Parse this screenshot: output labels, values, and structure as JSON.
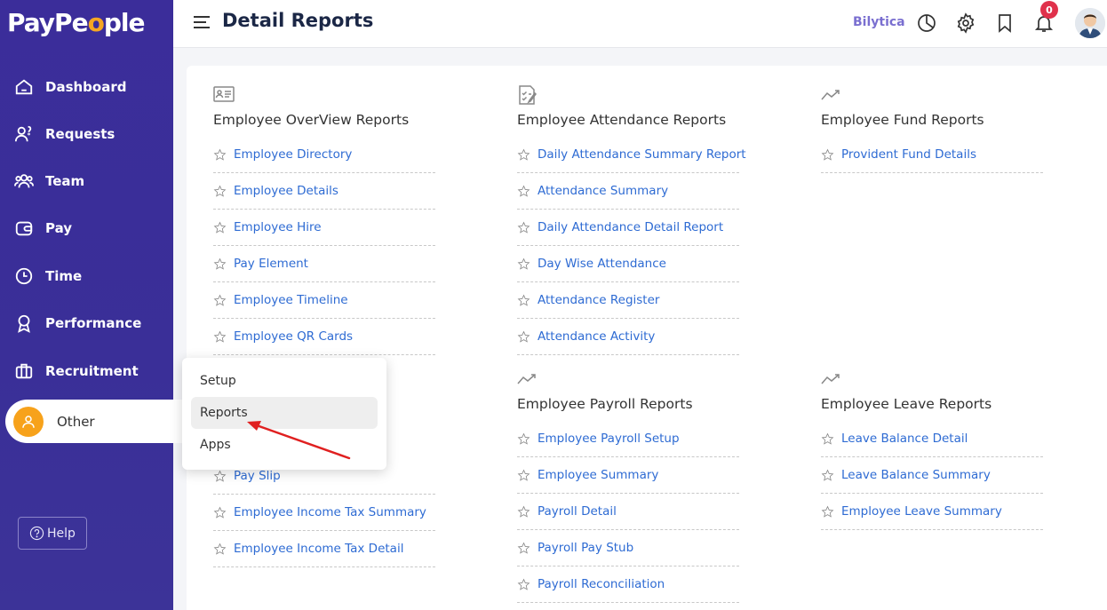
{
  "app": {
    "logo_main": "PayPe",
    "logo_accent": "o",
    "logo_end": "ple"
  },
  "sidebar": {
    "items": [
      {
        "label": "Dashboard",
        "icon": "home-icon"
      },
      {
        "label": "Requests",
        "icon": "requests-icon"
      },
      {
        "label": "Team",
        "icon": "team-icon"
      },
      {
        "label": "Pay",
        "icon": "wallet-icon"
      },
      {
        "label": "Time",
        "icon": "clock-icon"
      },
      {
        "label": "Performance",
        "icon": "award-icon"
      },
      {
        "label": "Recruitment",
        "icon": "briefcase-icon"
      }
    ],
    "other_label": "Other",
    "help_label": "Help"
  },
  "header": {
    "title": "Detail Reports",
    "org_name": "Bilytica",
    "notification_count": "0"
  },
  "sections": {
    "overview": {
      "title": "Employee OverView Reports",
      "items": [
        "Employee Directory",
        "Employee Details",
        "Employee Hire",
        "Pay Element",
        "Employee Timeline",
        "Employee QR Cards"
      ]
    },
    "attendance": {
      "title": "Employee Attendance Reports",
      "items": [
        "Daily Attendance Summary Report",
        "Attendance Summary",
        "Daily Attendance Detail Report",
        "Day Wise Attendance",
        "Attendance Register",
        "Attendance Activity"
      ]
    },
    "fund": {
      "title": "Employee Fund Reports",
      "items": [
        "Provident Fund Details"
      ]
    },
    "payslip": {
      "items": [
        "Pay Slip",
        "Employee Income Tax Summary",
        "Employee Income Tax Detail"
      ]
    },
    "payroll": {
      "title": "Employee Payroll Reports",
      "items": [
        "Employee Payroll Setup",
        "Employee Summary",
        "Payroll Detail",
        "Payroll Pay Stub",
        "Payroll Reconciliation"
      ]
    },
    "leave": {
      "title": "Employee Leave Reports",
      "items": [
        "Leave Balance Detail",
        "Leave Balance Summary",
        "Employee Leave Summary"
      ]
    }
  },
  "popup": {
    "items": [
      "Setup",
      "Reports",
      "Apps"
    ],
    "active": "Reports"
  },
  "colors": {
    "sidebar": "#3b2d9a",
    "link": "#2e6bd3",
    "accent": "#f5a623",
    "badge": "#e0314b",
    "arrow": "#e02020"
  }
}
